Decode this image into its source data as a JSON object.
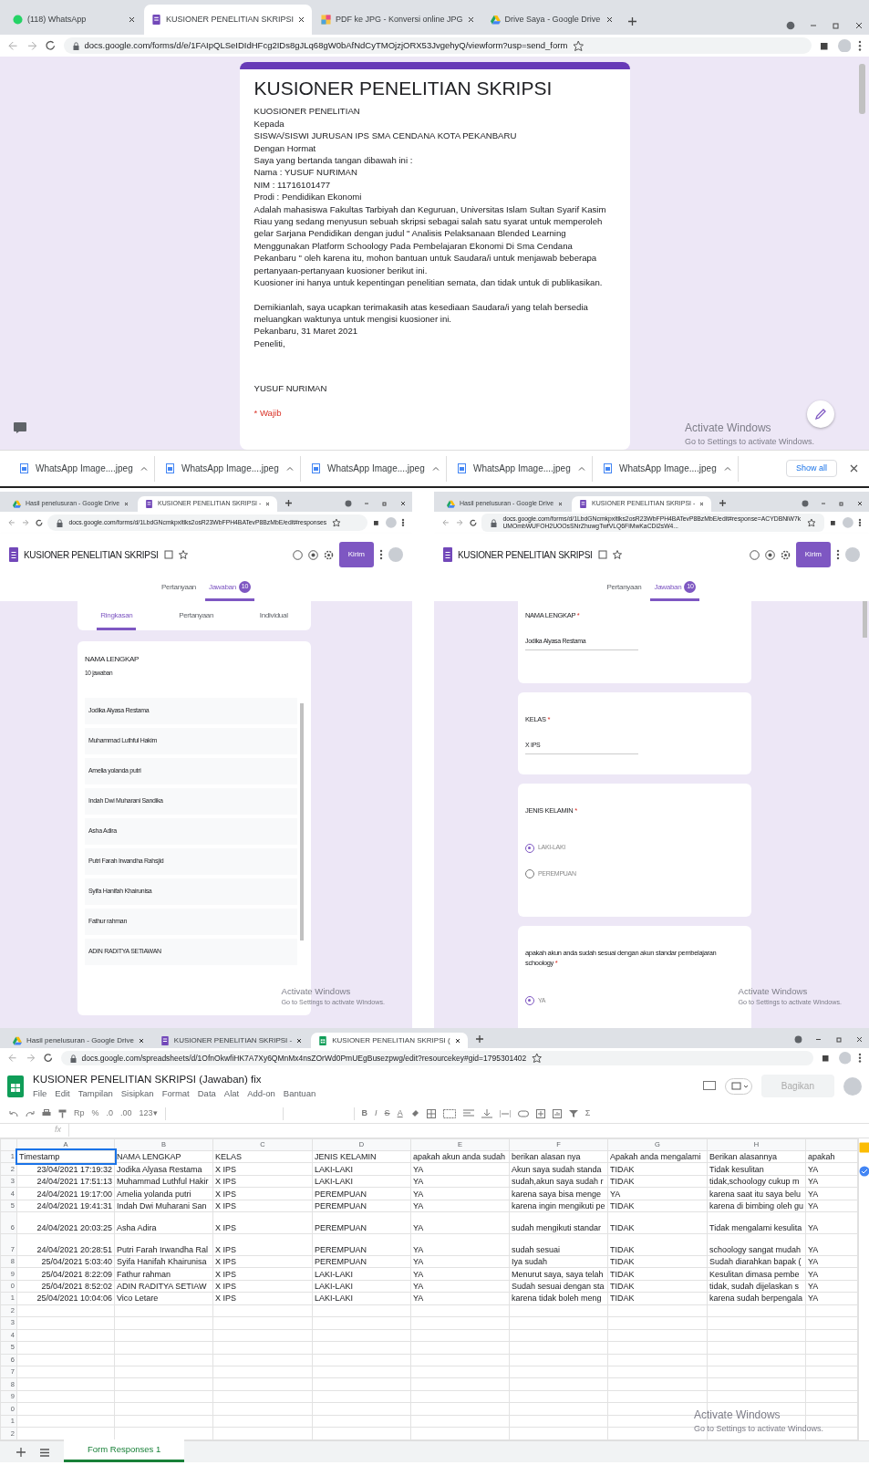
{
  "top_window": {
    "tabs": [
      {
        "label": "(118) WhatsApp",
        "selected": false,
        "kind": "whatsapp"
      },
      {
        "label": "KUSIONER PENELITIAN SKRIPSI",
        "selected": true,
        "kind": "forms"
      },
      {
        "label": "PDF ke JPG - Konversi online JPG",
        "selected": false,
        "kind": "pdf"
      },
      {
        "label": "Drive Saya - Google Drive",
        "selected": false,
        "kind": "drive"
      }
    ],
    "url": "docs.google.com/forms/d/e/1FAIpQLSeIDIdHFcg2IDs8gJLq68gW0bAfNdCyTMOjzjORX53JvgehyQ/viewform?usp=send_form",
    "form": {
      "title": "KUSIONER PENELITIAN SKRIPSI",
      "blocks": [
        [
          "KUOSIONER PENELITIAN",
          "Kepada",
          "SISWA/SISWI  JURUSAN IPS SMA CENDANA KOTA PEKANBARU",
          "Dengan Hormat",
          "Saya yang bertanda tangan dibawah ini :",
          "Nama : YUSUF NURIMAN",
          "NIM : 11716101477",
          "Prodi : Pendidikan Ekonomi",
          "Adalah mahasiswa Fakultas Tarbiyah dan Keguruan, Universitas Islam Sultan Syarif Kasim Riau yang sedang menyusun sebuah skripsi sebagai salah satu syarat untuk memperoleh gelar Sarjana Pendidikan dengan judul \" Analisis Pelaksanaan Blended Learning Menggunakan Platform Schoology Pada Pembelajaran Ekonomi Di Sma Cendana Pekanbaru \" oleh karena itu, mohon bantuan untuk Saudara/i untuk menjawab beberapa pertanyaan-pertanyaan kuosioner berikut ini.",
          "Kuosioner ini hanya untuk kepentingan penelitian semata, dan tidak untuk di publikasikan."
        ],
        [
          "Demikianlah, saya ucapkan terimakasih atas kesediaan Saudara/i yang telah bersedia meluangkan waktunya untuk mengisi kuosioner ini.",
          "Pekanbaru, 31  Maret 2021",
          "Peneliti,"
        ],
        [
          "YUSUF NURIMAN"
        ]
      ],
      "required_note": "* Wajib"
    },
    "downloads": [
      "WhatsApp Image....jpeg",
      "WhatsApp Image....jpeg",
      "WhatsApp Image....jpeg",
      "WhatsApp Image....jpeg",
      "WhatsApp Image....jpeg"
    ],
    "show_all": "Show all",
    "activation": {
      "title": "Activate Windows",
      "subtitle": "Go to Settings to activate Windows."
    }
  },
  "left_window": {
    "tabs": [
      {
        "label": "Hasil penelusuran - Google Drive",
        "selected": false,
        "kind": "drive"
      },
      {
        "label": "KUSIONER PENELITIAN SKRIPSI -",
        "selected": true,
        "kind": "forms"
      }
    ],
    "url": "docs.google.com/forms/d/1LbdGNcmkpxltlks2osR23WbFPH4BATevP8BzMbE/edit#responses",
    "app_title": "KUSIONER PENELITIAN SKRIPSI",
    "send": "Kirim",
    "view_tabs": [
      {
        "label": "Pertanyaan",
        "selected": false
      },
      {
        "label": "Jawaban",
        "selected": true,
        "count": "10"
      }
    ],
    "sub_tabs": [
      {
        "label": "Ringkasan",
        "selected": true
      },
      {
        "label": "Pertanyaan",
        "selected": false
      },
      {
        "label": "Individual",
        "selected": false
      }
    ],
    "summary": {
      "question": "NAMA LENGKAP",
      "count": "10 jawaban",
      "answers": [
        "Jodika Alyasa Restama",
        "Muhammad Luthful Hakim",
        "Amelia yolanda putri",
        "Indah Dwi Muharani Sandika",
        "Asha Adira",
        "Putri Farah Irwandha Rahsjid",
        "Syifa Hanifah Khairunisa",
        "Fathur rahman",
        "ADIN RADITYA SETIAWAN"
      ]
    },
    "activation": {
      "title": "Activate Windows",
      "subtitle": "Go to Settings to activate Windows."
    }
  },
  "right_window": {
    "tabs": [
      {
        "label": "Hasil penelusuran - Google Drive",
        "selected": false,
        "kind": "drive"
      },
      {
        "label": "KUSIONER PENELITIAN SKRIPSI -",
        "selected": true,
        "kind": "forms"
      }
    ],
    "url": "docs.google.com/forms/d/1LbdGNcmkpxltlks2osR23WbFPH4BATevP8BzMbE/edit#response=ACYDBNiW7kUMOmbWUFOH2UOOsSNrZhuwgTwfVLQ6FiMwKaCDi2sW4...",
    "app_title": "KUSIONER PENELITIAN SKRIPSI",
    "send": "Kirim",
    "view_tabs": [
      {
        "label": "Pertanyaan",
        "selected": false
      },
      {
        "label": "Jawaban",
        "selected": true,
        "count": "10"
      }
    ],
    "questions": [
      {
        "kind": "text",
        "label": "NAMA LENGKAP",
        "required_mark": "*",
        "value": "Jodika Alyasa Restama"
      },
      {
        "kind": "text",
        "label": "KELAS",
        "required_mark": "*",
        "value": "X IPS"
      },
      {
        "kind": "choice",
        "label": "JENIS KELAMIN",
        "required_mark": "*",
        "options": [
          {
            "label": "LAKI-LAKI",
            "selected": true
          },
          {
            "label": "PEREMPUAN",
            "selected": false
          }
        ]
      },
      {
        "kind": "choice",
        "label": "apakah akun anda sudah sesuai dengan akun standar pembelajaran schoology",
        "required_mark": "*",
        "options": [
          {
            "label": "YA",
            "selected": true
          }
        ]
      }
    ],
    "activation": {
      "title": "Activate Windows",
      "subtitle": "Go to Settings to activate Windows."
    }
  },
  "sheet_window": {
    "tabs": [
      {
        "label": "Hasil penelusuran - Google Drive",
        "selected": false,
        "kind": "drive"
      },
      {
        "label": "KUSIONER PENELITIAN SKRIPSI -",
        "selected": false,
        "kind": "forms"
      },
      {
        "label": "KUSIONER PENELITIAN SKRIPSI (",
        "selected": true,
        "kind": "sheets"
      }
    ],
    "url": "docs.google.com/spreadsheets/d/1OfnOkwfiHK7A7Xy6QMnMx4nsZOrWd0PmUEgBusezpwg/edit?resourcekey#gid=1795301402",
    "title": "KUSIONER PENELITIAN SKRIPSI  (Jawaban) fix",
    "menu": [
      "File",
      "Edit",
      "Tampilan",
      "Sisipkan",
      "Format",
      "Data",
      "Alat",
      "Add-on",
      "Bantuan"
    ],
    "share": "Bagikan",
    "number_formats": [
      "Rp",
      "%",
      ".0",
      ".00",
      "123▾"
    ],
    "text_formats": [
      "B",
      "I",
      "S",
      "A"
    ],
    "function_button": "Σ",
    "formula_label": "fx",
    "columns": [
      "A",
      "B",
      "C",
      "D",
      "E",
      "F",
      "G",
      "H"
    ],
    "rows": [
      {
        "number": "1",
        "tall": false,
        "cells": [
          "Timestamp",
          "NAMA LENGKAP",
          "KELAS",
          "JENIS KELAMIN",
          "apakah akun anda sudah",
          "berikan alasan nya",
          "Apakah anda mengalami",
          "Berikan alasannya",
          "apakah"
        ]
      },
      {
        "number": "2",
        "tall": false,
        "cells": [
          "23/04/2021 17:19:32",
          "Jodika Alyasa Restama",
          "X IPS",
          "LAKI-LAKI",
          "YA",
          "Akun saya sudah standa",
          "TIDAK",
          "Tidak kesulitan",
          "YA"
        ]
      },
      {
        "number": "3",
        "tall": false,
        "cells": [
          "24/04/2021 17:51:13",
          "Muhammad Luthful Hakir",
          "X IPS",
          "LAKI-LAKI",
          "YA",
          "sudah,akun saya sudah r",
          "TIDAK",
          "tidak,schoology cukup m",
          "YA"
        ]
      },
      {
        "number": "4",
        "tall": false,
        "cells": [
          "24/04/2021 19:17:00",
          "Amelia yolanda putri",
          "X IPS",
          "PEREMPUAN",
          "YA",
          "karena saya bisa menge",
          "YA",
          "karena saat itu saya belu",
          "YA"
        ]
      },
      {
        "number": "5",
        "tall": false,
        "cells": [
          "24/04/2021 19:41:31",
          "Indah Dwi Muharani San",
          "X IPS",
          "PEREMPUAN",
          "YA",
          "karena ingin mengikuti pe",
          "TIDAK",
          "karena di bimbing oleh gu",
          "YA"
        ]
      },
      {
        "number": "6",
        "tall": true,
        "cells": [
          "24/04/2021 20:03:25",
          "Asha Adira",
          "X IPS",
          "PEREMPUAN",
          "YA",
          "sudah mengikuti standar",
          "TIDAK",
          "Tidak mengalami kesulita",
          "YA"
        ]
      },
      {
        "number": "7",
        "tall": true,
        "cells": [
          "24/04/2021 20:28:51",
          "Putri Farah Irwandha Ral",
          "X IPS",
          "PEREMPUAN",
          "YA",
          "sudah sesuai",
          "TIDAK",
          "schoology sangat mudah",
          "YA"
        ]
      },
      {
        "number": "8",
        "tall": false,
        "cells": [
          "25/04/2021 5:03:40",
          "Syifa Hanifah Khairunisa",
          "X IPS",
          "PEREMPUAN",
          "YA",
          "Iya sudah",
          "TIDAK",
          "Sudah diarahkan bapak (",
          "YA"
        ]
      },
      {
        "number": "9",
        "tall": false,
        "cells": [
          "25/04/2021 8:22:09",
          "Fathur rahman",
          "X IPS",
          "LAKI-LAKI",
          "YA",
          "Menurut saya, saya telah",
          "TIDAK",
          "Kesulitan dimasa pembe",
          "YA"
        ]
      },
      {
        "number": "0",
        "tall": false,
        "cells": [
          "25/04/2021 8:52:02",
          "ADIN RADITYA SETIAW",
          "X IPS",
          "LAKI-LAKI",
          "YA",
          "Sudah sesuai dengan sta",
          "TIDAK",
          "tidak, sudah dijelaskan s",
          "YA"
        ]
      },
      {
        "number": "1",
        "tall": false,
        "cells": [
          "25/04/2021 10:04:06",
          "Vico Letare",
          "X IPS",
          "LAKI-LAKI",
          "YA",
          "karena tidak boleh meng",
          "TIDAK",
          "karena sudah berpengala",
          "YA"
        ]
      },
      {
        "number": "2",
        "tall": false,
        "cells": []
      },
      {
        "number": "3",
        "tall": false,
        "cells": []
      },
      {
        "number": "4",
        "tall": false,
        "cells": []
      },
      {
        "number": "5",
        "tall": false,
        "cells": []
      },
      {
        "number": "6",
        "tall": false,
        "cells": []
      },
      {
        "number": "7",
        "tall": false,
        "cells": []
      },
      {
        "number": "8",
        "tall": false,
        "cells": []
      },
      {
        "number": "9",
        "tall": false,
        "cells": []
      },
      {
        "number": "0",
        "tall": false,
        "cells": []
      },
      {
        "number": "1",
        "tall": false,
        "cells": []
      },
      {
        "number": "2",
        "tall": false,
        "cells": []
      }
    ],
    "sheet_tab": "Form Responses 1",
    "activation": {
      "title": "Activate Windows",
      "subtitle": "Go to Settings to activate Windows."
    }
  }
}
